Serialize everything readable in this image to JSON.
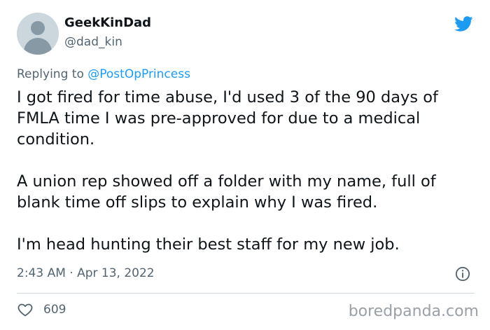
{
  "author": {
    "display_name": "GeekKinDad",
    "handle": "@dad_kin",
    "avatar_icon": "default-avatar-icon"
  },
  "brand_icon": "twitter-bird-icon",
  "reply": {
    "prefix": "Replying to ",
    "mention": "@PostOpPrincess"
  },
  "tweet": {
    "paragraphs": [
      "I got fired for time abuse, I'd used 3 of the 90 days of FMLA time I was pre-approved for due to a medical condition.",
      "A union rep showed off a folder with my name, full of blank time off slips to explain why I was fired.",
      "I'm head hunting their best staff for my new job."
    ],
    "timestamp": "2:43 AM · Apr 13, 2022"
  },
  "stats": {
    "likes": "609"
  },
  "watermark": "boredpanda.com",
  "colors": {
    "accent": "#1d9bf0",
    "text": "#0f1419",
    "muted": "#536471"
  }
}
